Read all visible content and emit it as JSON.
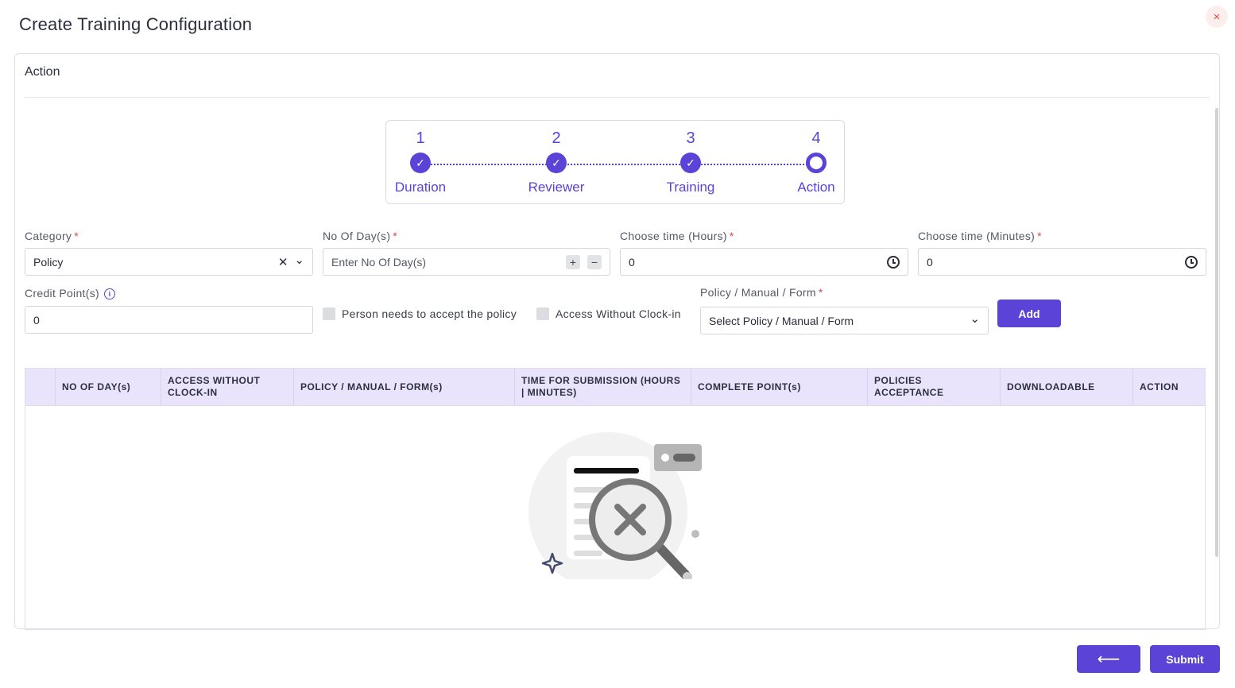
{
  "modal": {
    "title": "Create Training Configuration",
    "close_icon": "×"
  },
  "card": {
    "header": "Action"
  },
  "stepper": {
    "steps": [
      {
        "num": "1",
        "label": "Duration",
        "state": "done"
      },
      {
        "num": "2",
        "label": "Reviewer",
        "state": "done"
      },
      {
        "num": "3",
        "label": "Training",
        "state": "done"
      },
      {
        "num": "4",
        "label": "Action",
        "state": "current"
      }
    ],
    "check_glyph": "✓"
  },
  "form": {
    "category": {
      "label": "Category",
      "value": "Policy",
      "clear_glyph": "✕",
      "chevron_glyph": "⌄"
    },
    "days": {
      "label": "No Of Day(s)",
      "placeholder": "Enter No Of Day(s)",
      "plus": "+",
      "minus": "−"
    },
    "hours": {
      "label": "Choose time (Hours)",
      "value": "0"
    },
    "minutes": {
      "label": "Choose time (Minutes)",
      "value": "0"
    },
    "credit": {
      "label": "Credit Point(s)",
      "value": "0",
      "info": "i"
    },
    "accept_policy": {
      "label": "Person needs to accept the policy"
    },
    "access_without_clockin": {
      "label": "Access Without Clock-in"
    },
    "policy": {
      "label": "Policy / Manual / Form",
      "placeholder": "Select Policy / Manual / Form",
      "chevron_glyph": "⌄"
    },
    "required_mark": "*",
    "add_label": "Add"
  },
  "table": {
    "columns": [
      "",
      "NO OF DAY(s)",
      "ACCESS WITHOUT CLOCK-IN",
      "POLICY / MANUAL / FORM(s)",
      "TIME FOR SUBMISSION (HOURS | MINUTES)",
      "COMPLETE POINT(s)",
      "POLICIES ACCEPTANCE",
      "DOWNLOADABLE",
      "ACTION"
    ]
  },
  "footer": {
    "back_glyph": "⟵",
    "submit_label": "Submit"
  }
}
